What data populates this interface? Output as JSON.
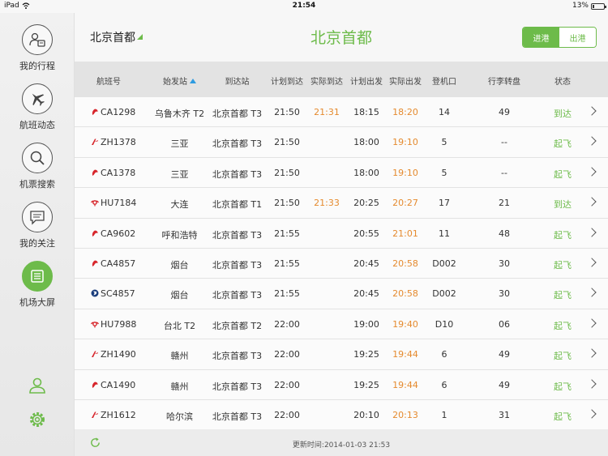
{
  "status_bar": {
    "device": "iPad",
    "time": "21:54",
    "battery": "13%",
    "battery_level": 0.13
  },
  "sidebar": {
    "items": [
      {
        "label": "我的行程",
        "icon": "itinerary-icon"
      },
      {
        "label": "航班动态",
        "icon": "airplane-icon"
      },
      {
        "label": "机票搜索",
        "icon": "search-icon"
      },
      {
        "label": "我的关注",
        "icon": "message-icon"
      },
      {
        "label": "机场大屏",
        "icon": "airport-screen-icon"
      }
    ],
    "active_index": 4,
    "bottom_icons": [
      "user-icon",
      "settings-gear-icon"
    ]
  },
  "header": {
    "city": "北京首都",
    "title": "北京首都",
    "tabs": [
      {
        "label": "进港"
      },
      {
        "label": "出港"
      }
    ],
    "active_tab": 0
  },
  "table": {
    "columns": [
      "航班号",
      "始发站",
      "到达站",
      "计划到达",
      "实际到达",
      "计划出发",
      "实际出发",
      "登机口",
      "行李转盘",
      "状态"
    ],
    "rows": [
      {
        "flight": "CA1298",
        "airline": "air-china",
        "origin": "乌鲁木齐 T2",
        "dest": "北京首都 T3",
        "sched_arr": "21:50",
        "act_arr": "21:31",
        "sched_dep": "18:15",
        "act_dep": "18:20",
        "gate": "14",
        "carousel": "49",
        "status": "到达"
      },
      {
        "flight": "ZH1378",
        "airline": "shenzhen-airlines",
        "origin": "三亚",
        "dest": "北京首都 T3",
        "sched_arr": "21:50",
        "act_arr": "",
        "sched_dep": "18:00",
        "act_dep": "19:10",
        "gate": "5",
        "carousel": "--",
        "status": "起飞"
      },
      {
        "flight": "CA1378",
        "airline": "air-china",
        "origin": "三亚",
        "dest": "北京首都 T3",
        "sched_arr": "21:50",
        "act_arr": "",
        "sched_dep": "18:00",
        "act_dep": "19:10",
        "gate": "5",
        "carousel": "--",
        "status": "起飞"
      },
      {
        "flight": "HU7184",
        "airline": "hainan-airlines",
        "origin": "大连",
        "dest": "北京首都 T1",
        "sched_arr": "21:50",
        "act_arr": "21:33",
        "sched_dep": "20:25",
        "act_dep": "20:27",
        "gate": "17",
        "carousel": "21",
        "status": "到达"
      },
      {
        "flight": "CA9602",
        "airline": "air-china",
        "origin": "呼和浩特",
        "dest": "北京首都 T3",
        "sched_arr": "21:55",
        "act_arr": "",
        "sched_dep": "20:55",
        "act_dep": "21:01",
        "gate": "11",
        "carousel": "48",
        "status": "起飞"
      },
      {
        "flight": "CA4857",
        "airline": "air-china",
        "origin": "烟台",
        "dest": "北京首都 T3",
        "sched_arr": "21:55",
        "act_arr": "",
        "sched_dep": "20:45",
        "act_dep": "20:58",
        "gate": "D002",
        "carousel": "30",
        "status": "起飞"
      },
      {
        "flight": "SC4857",
        "airline": "shandong-airlines",
        "origin": "烟台",
        "dest": "北京首都 T3",
        "sched_arr": "21:55",
        "act_arr": "",
        "sched_dep": "20:45",
        "act_dep": "20:58",
        "gate": "D002",
        "carousel": "30",
        "status": "起飞"
      },
      {
        "flight": "HU7988",
        "airline": "hainan-airlines",
        "origin": "台北 T2",
        "dest": "北京首都 T2",
        "sched_arr": "22:00",
        "act_arr": "",
        "sched_dep": "19:00",
        "act_dep": "19:40",
        "gate": "D10",
        "carousel": "06",
        "status": "起飞"
      },
      {
        "flight": "ZH1490",
        "airline": "shenzhen-airlines",
        "origin": "赣州",
        "dest": "北京首都 T3",
        "sched_arr": "22:00",
        "act_arr": "",
        "sched_dep": "19:25",
        "act_dep": "19:44",
        "gate": "6",
        "carousel": "49",
        "status": "起飞"
      },
      {
        "flight": "CA1490",
        "airline": "air-china",
        "origin": "赣州",
        "dest": "北京首都 T3",
        "sched_arr": "22:00",
        "act_arr": "",
        "sched_dep": "19:25",
        "act_dep": "19:44",
        "gate": "6",
        "carousel": "49",
        "status": "起飞"
      },
      {
        "flight": "ZH1612",
        "airline": "shenzhen-airlines",
        "origin": "哈尔滨",
        "dest": "北京首都 T3",
        "sched_arr": "22:00",
        "act_arr": "",
        "sched_dep": "20:10",
        "act_dep": "20:13",
        "gate": "1",
        "carousel": "31",
        "status": "起飞"
      }
    ]
  },
  "footer": {
    "update_text": "更新时间:2014-01-03 21:53"
  },
  "colors": {
    "accent": "#6dbb4a",
    "time_highlight": "#e58a2e",
    "sort_indicator": "#2e9be0",
    "air_china": "#d7262c",
    "shandong": "#1a3d7c"
  }
}
